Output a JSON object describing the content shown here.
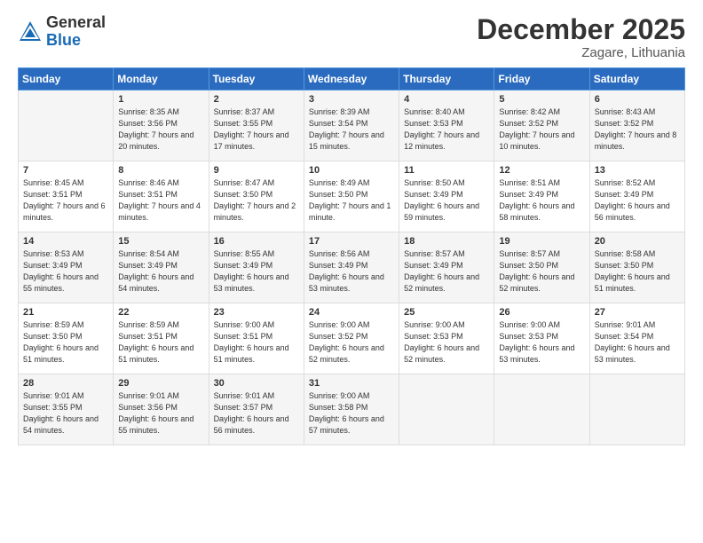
{
  "logo": {
    "general": "General",
    "blue": "Blue"
  },
  "title": "December 2025",
  "location": "Zagare, Lithuania",
  "days_header": [
    "Sunday",
    "Monday",
    "Tuesday",
    "Wednesday",
    "Thursday",
    "Friday",
    "Saturday"
  ],
  "weeks": [
    [
      {
        "day": "",
        "info": ""
      },
      {
        "day": "1",
        "info": "Sunrise: 8:35 AM\nSunset: 3:56 PM\nDaylight: 7 hours\nand 20 minutes."
      },
      {
        "day": "2",
        "info": "Sunrise: 8:37 AM\nSunset: 3:55 PM\nDaylight: 7 hours\nand 17 minutes."
      },
      {
        "day": "3",
        "info": "Sunrise: 8:39 AM\nSunset: 3:54 PM\nDaylight: 7 hours\nand 15 minutes."
      },
      {
        "day": "4",
        "info": "Sunrise: 8:40 AM\nSunset: 3:53 PM\nDaylight: 7 hours\nand 12 minutes."
      },
      {
        "day": "5",
        "info": "Sunrise: 8:42 AM\nSunset: 3:52 PM\nDaylight: 7 hours\nand 10 minutes."
      },
      {
        "day": "6",
        "info": "Sunrise: 8:43 AM\nSunset: 3:52 PM\nDaylight: 7 hours\nand 8 minutes."
      }
    ],
    [
      {
        "day": "7",
        "info": "Sunrise: 8:45 AM\nSunset: 3:51 PM\nDaylight: 7 hours\nand 6 minutes."
      },
      {
        "day": "8",
        "info": "Sunrise: 8:46 AM\nSunset: 3:51 PM\nDaylight: 7 hours\nand 4 minutes."
      },
      {
        "day": "9",
        "info": "Sunrise: 8:47 AM\nSunset: 3:50 PM\nDaylight: 7 hours\nand 2 minutes."
      },
      {
        "day": "10",
        "info": "Sunrise: 8:49 AM\nSunset: 3:50 PM\nDaylight: 7 hours\nand 1 minute."
      },
      {
        "day": "11",
        "info": "Sunrise: 8:50 AM\nSunset: 3:49 PM\nDaylight: 6 hours\nand 59 minutes."
      },
      {
        "day": "12",
        "info": "Sunrise: 8:51 AM\nSunset: 3:49 PM\nDaylight: 6 hours\nand 58 minutes."
      },
      {
        "day": "13",
        "info": "Sunrise: 8:52 AM\nSunset: 3:49 PM\nDaylight: 6 hours\nand 56 minutes."
      }
    ],
    [
      {
        "day": "14",
        "info": "Sunrise: 8:53 AM\nSunset: 3:49 PM\nDaylight: 6 hours\nand 55 minutes."
      },
      {
        "day": "15",
        "info": "Sunrise: 8:54 AM\nSunset: 3:49 PM\nDaylight: 6 hours\nand 54 minutes."
      },
      {
        "day": "16",
        "info": "Sunrise: 8:55 AM\nSunset: 3:49 PM\nDaylight: 6 hours\nand 53 minutes."
      },
      {
        "day": "17",
        "info": "Sunrise: 8:56 AM\nSunset: 3:49 PM\nDaylight: 6 hours\nand 53 minutes."
      },
      {
        "day": "18",
        "info": "Sunrise: 8:57 AM\nSunset: 3:49 PM\nDaylight: 6 hours\nand 52 minutes."
      },
      {
        "day": "19",
        "info": "Sunrise: 8:57 AM\nSunset: 3:50 PM\nDaylight: 6 hours\nand 52 minutes."
      },
      {
        "day": "20",
        "info": "Sunrise: 8:58 AM\nSunset: 3:50 PM\nDaylight: 6 hours\nand 51 minutes."
      }
    ],
    [
      {
        "day": "21",
        "info": "Sunrise: 8:59 AM\nSunset: 3:50 PM\nDaylight: 6 hours\nand 51 minutes."
      },
      {
        "day": "22",
        "info": "Sunrise: 8:59 AM\nSunset: 3:51 PM\nDaylight: 6 hours\nand 51 minutes."
      },
      {
        "day": "23",
        "info": "Sunrise: 9:00 AM\nSunset: 3:51 PM\nDaylight: 6 hours\nand 51 minutes."
      },
      {
        "day": "24",
        "info": "Sunrise: 9:00 AM\nSunset: 3:52 PM\nDaylight: 6 hours\nand 52 minutes."
      },
      {
        "day": "25",
        "info": "Sunrise: 9:00 AM\nSunset: 3:53 PM\nDaylight: 6 hours\nand 52 minutes."
      },
      {
        "day": "26",
        "info": "Sunrise: 9:00 AM\nSunset: 3:53 PM\nDaylight: 6 hours\nand 53 minutes."
      },
      {
        "day": "27",
        "info": "Sunrise: 9:01 AM\nSunset: 3:54 PM\nDaylight: 6 hours\nand 53 minutes."
      }
    ],
    [
      {
        "day": "28",
        "info": "Sunrise: 9:01 AM\nSunset: 3:55 PM\nDaylight: 6 hours\nand 54 minutes."
      },
      {
        "day": "29",
        "info": "Sunrise: 9:01 AM\nSunset: 3:56 PM\nDaylight: 6 hours\nand 55 minutes."
      },
      {
        "day": "30",
        "info": "Sunrise: 9:01 AM\nSunset: 3:57 PM\nDaylight: 6 hours\nand 56 minutes."
      },
      {
        "day": "31",
        "info": "Sunrise: 9:00 AM\nSunset: 3:58 PM\nDaylight: 6 hours\nand 57 minutes."
      },
      {
        "day": "",
        "info": ""
      },
      {
        "day": "",
        "info": ""
      },
      {
        "day": "",
        "info": ""
      }
    ]
  ]
}
